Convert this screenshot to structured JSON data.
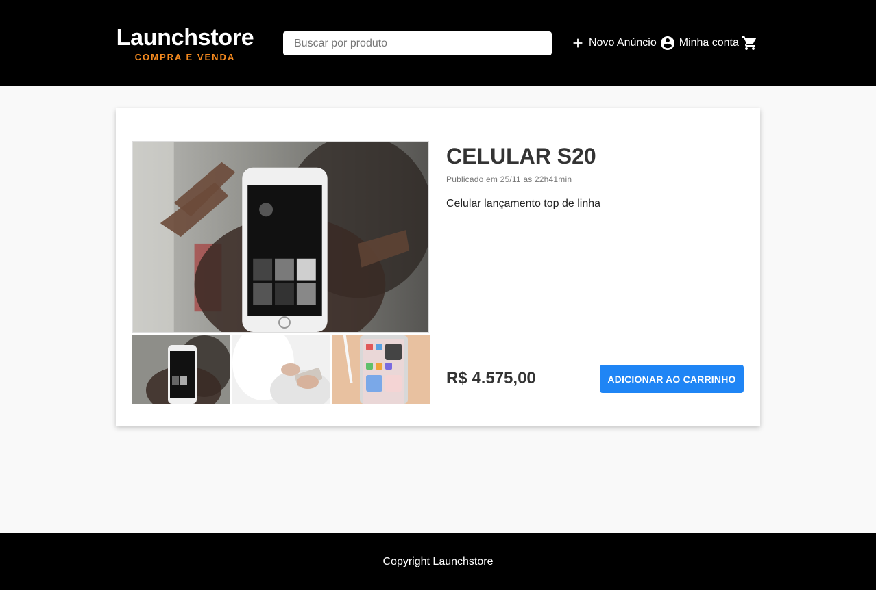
{
  "header": {
    "logo_title": "Launchstore",
    "logo_subtitle": "COMPRA E VENDA",
    "search_placeholder": "Buscar por produto",
    "nav": {
      "new_ad_label": "Novo Anúncio",
      "account_label": "Minha conta"
    },
    "icons": [
      "plus-icon",
      "account-circle-icon",
      "shopping-cart-icon"
    ]
  },
  "product": {
    "title": "CELULAR S20",
    "published": "Publicado em 25/11 as 22h41min",
    "description": "Celular lançamento top de linha",
    "price": "R$ 4.575,00",
    "add_to_cart_label": "ADICIONAR AO CARRINHO"
  },
  "footer": {
    "copyright": "Copyright Launchstore"
  },
  "colors": {
    "header_bg": "#000000",
    "accent_orange": "#f58a1f",
    "button_blue": "#1f85f5",
    "page_bg": "#f9f9f9"
  }
}
